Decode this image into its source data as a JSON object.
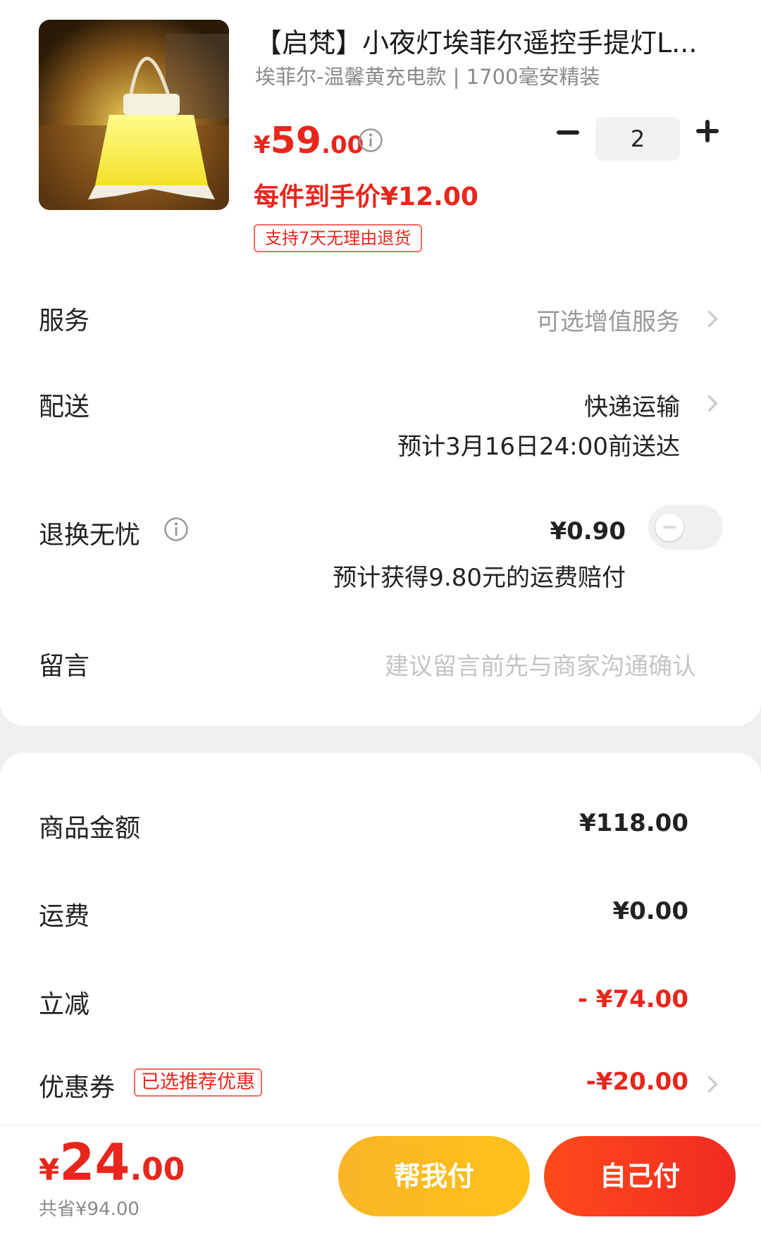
{
  "product": {
    "title": "【启梵】小夜灯埃菲尔遥控手提灯L...",
    "spec": "埃菲尔-温馨黄充电款 | 1700毫安精装",
    "price_symbol": "¥",
    "price_int": "59",
    "price_dec": ".00",
    "per_item_price": "每件到手价¥12.00",
    "return_tag": "支持7天无理由退货",
    "quantity": "2"
  },
  "service": {
    "label": "服务",
    "value": "可选增值服务"
  },
  "delivery": {
    "label": "配送",
    "method": "快递运输",
    "eta": "预计3月16日24:00前送达"
  },
  "return_insurance": {
    "label": "退换无忧",
    "price": "¥0.90",
    "note": "预计获得9.80元的运费赔付",
    "enabled": false
  },
  "message": {
    "label": "留言",
    "placeholder": "建议留言前先与商家沟通确认"
  },
  "summary": {
    "goods_label": "商品金额",
    "goods_value": "¥118.00",
    "shipping_label": "运费",
    "shipping_value": "¥0.00",
    "discount_label": "立减",
    "discount_value": "- ¥74.00",
    "coupon_label": "优惠券",
    "coupon_tag": "已选推荐优惠",
    "coupon_value": "-¥20.00"
  },
  "bottom": {
    "total_symbol": "¥",
    "total_int": "24",
    "total_dec": ".00",
    "saved": "共省¥94.00",
    "help_pay": "帮我付",
    "self_pay": "自己付"
  },
  "colors": {
    "accent": "#e8261c",
    "help_button": "#ffc21a",
    "self_button": "#f02b22"
  }
}
